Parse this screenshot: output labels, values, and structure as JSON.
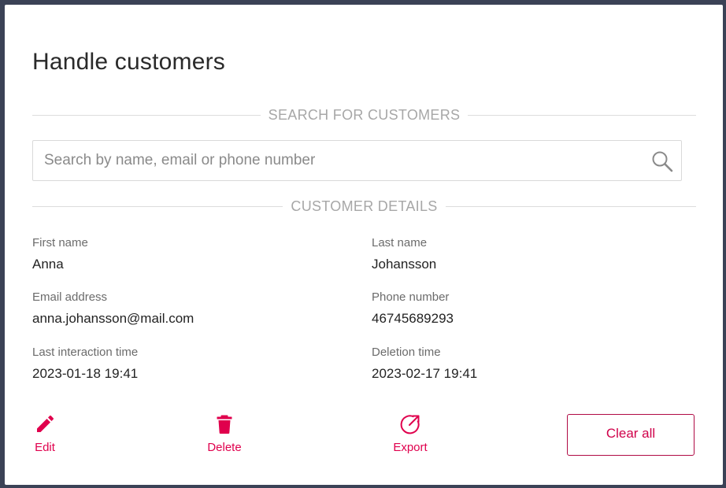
{
  "title": "Handle customers",
  "search_section": {
    "heading": "SEARCH FOR CUSTOMERS",
    "placeholder": "Search by name, email or phone number",
    "value": "",
    "icon": "search-icon"
  },
  "details_section": {
    "heading": "CUSTOMER DETAILS",
    "fields": {
      "first_name": {
        "label": "First name",
        "value": "Anna"
      },
      "last_name": {
        "label": "Last name",
        "value": "Johansson"
      },
      "email": {
        "label": "Email address",
        "value": "anna.johansson@mail.com"
      },
      "phone": {
        "label": "Phone number",
        "value": "46745689293"
      },
      "last_interaction": {
        "label": "Last interaction time",
        "value": "2023-01-18 19:41"
      },
      "deletion": {
        "label": "Deletion time",
        "value": "2023-02-17 19:41"
      }
    }
  },
  "actions": {
    "edit": {
      "label": "Edit",
      "icon": "pencil-icon"
    },
    "delete": {
      "label": "Delete",
      "icon": "trash-icon"
    },
    "export": {
      "label": "Export",
      "icon": "export-icon"
    },
    "clear_all": {
      "label": "Clear all"
    }
  },
  "colors": {
    "accent": "#e0004d",
    "background": "#3b4256",
    "dialog": "#ffffff"
  }
}
